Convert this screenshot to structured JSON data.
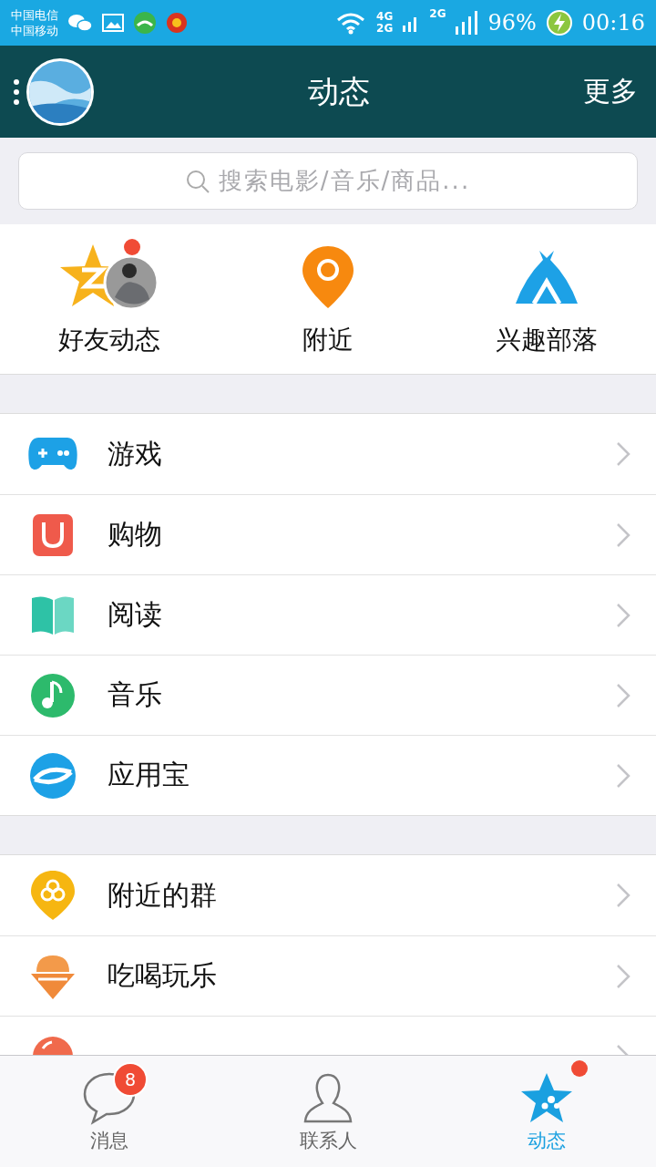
{
  "status_bar": {
    "carriers": [
      "中国电信",
      "中国移动"
    ],
    "net_top": "4G",
    "net_bottom": "2G",
    "net_second": "2G",
    "battery": "96%",
    "time": "00:16"
  },
  "header": {
    "title": "动态",
    "more": "更多"
  },
  "search": {
    "placeholder": "搜索电影/音乐/商品..."
  },
  "shortcuts": [
    {
      "label": "好友动态",
      "kind": "friends",
      "dot": true
    },
    {
      "label": "附近",
      "kind": "nearby",
      "dot": false
    },
    {
      "label": "兴趣部落",
      "kind": "tribe",
      "dot": false
    }
  ],
  "groups": [
    [
      {
        "label": "游戏",
        "kind": "game"
      },
      {
        "label": "购物",
        "kind": "shop"
      },
      {
        "label": "阅读",
        "kind": "read"
      },
      {
        "label": "音乐",
        "kind": "music"
      },
      {
        "label": "应用宝",
        "kind": "appstore"
      }
    ],
    [
      {
        "label": "附近的群",
        "kind": "groups"
      },
      {
        "label": "吃喝玩乐",
        "kind": "food"
      },
      {
        "kind": "city"
      }
    ]
  ],
  "tabs": [
    {
      "label": "消息",
      "kind": "chat",
      "selected": false,
      "badge": "8",
      "dot": false
    },
    {
      "label": "联系人",
      "kind": "contact",
      "selected": false,
      "dot": false
    },
    {
      "label": "动态",
      "kind": "star",
      "selected": true,
      "dot": true
    }
  ]
}
